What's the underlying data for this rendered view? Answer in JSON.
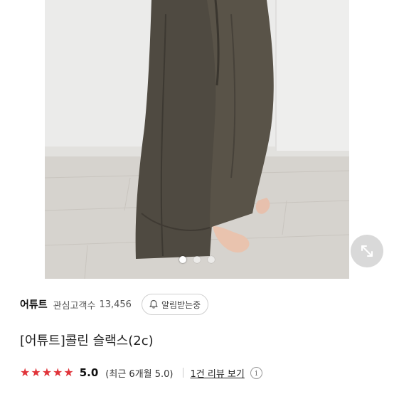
{
  "product_image": {
    "dots": [
      {
        "active": true
      },
      {
        "active": false
      },
      {
        "active": false
      }
    ],
    "expand_icon": "expand-diagonal-icon"
  },
  "store": {
    "name": "어튜트",
    "follower_label": "관심고객수",
    "follower_count": "13,456",
    "alert_label": "알림받는중",
    "alert_icon": "bell-icon"
  },
  "product": {
    "title": "[어튜트]콜린 슬랙스(2c)"
  },
  "rating": {
    "star_count": 5,
    "star_color": "#e0343a",
    "score": "5.0",
    "recent_text": "(최근 6개월 5.0)",
    "review_link": "1건 리뷰 보기",
    "info_icon": "info-icon"
  }
}
